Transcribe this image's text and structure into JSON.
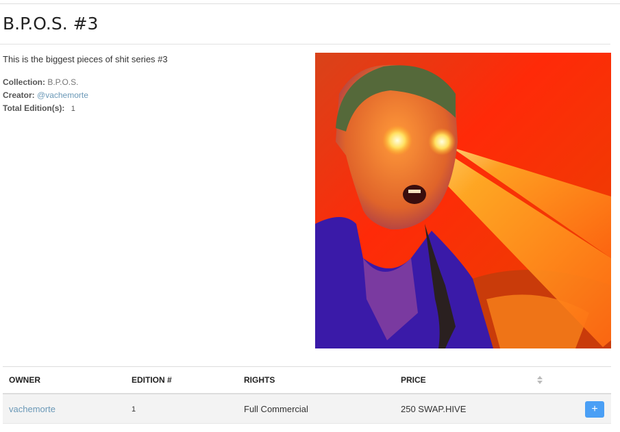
{
  "nft": {
    "title": "B.P.O.S. #3",
    "description": "This is the biggest pieces of shit series #3",
    "collection_label": "Collection:",
    "collection_value": "B.P.O.S.",
    "creator_label": "Creator:",
    "creator_value": "@vachemorte",
    "editions_label": "Total Edition(s):",
    "editions_value": "1"
  },
  "table": {
    "headers": {
      "owner": "OWNER",
      "edition": "EDITION #",
      "rights": "RIGHTS",
      "price": "PRICE"
    },
    "rows": [
      {
        "owner": "vachemorte",
        "edition": "1",
        "rights": "Full Commercial",
        "price": "250 SWAP.HIVE",
        "action": "+"
      }
    ]
  },
  "colors": {
    "link": "#6a98b7",
    "button": "#4a9ff5",
    "row_bg": "#f3f3f3"
  },
  "icons": [
    "sort-icon",
    "plus-icon"
  ]
}
